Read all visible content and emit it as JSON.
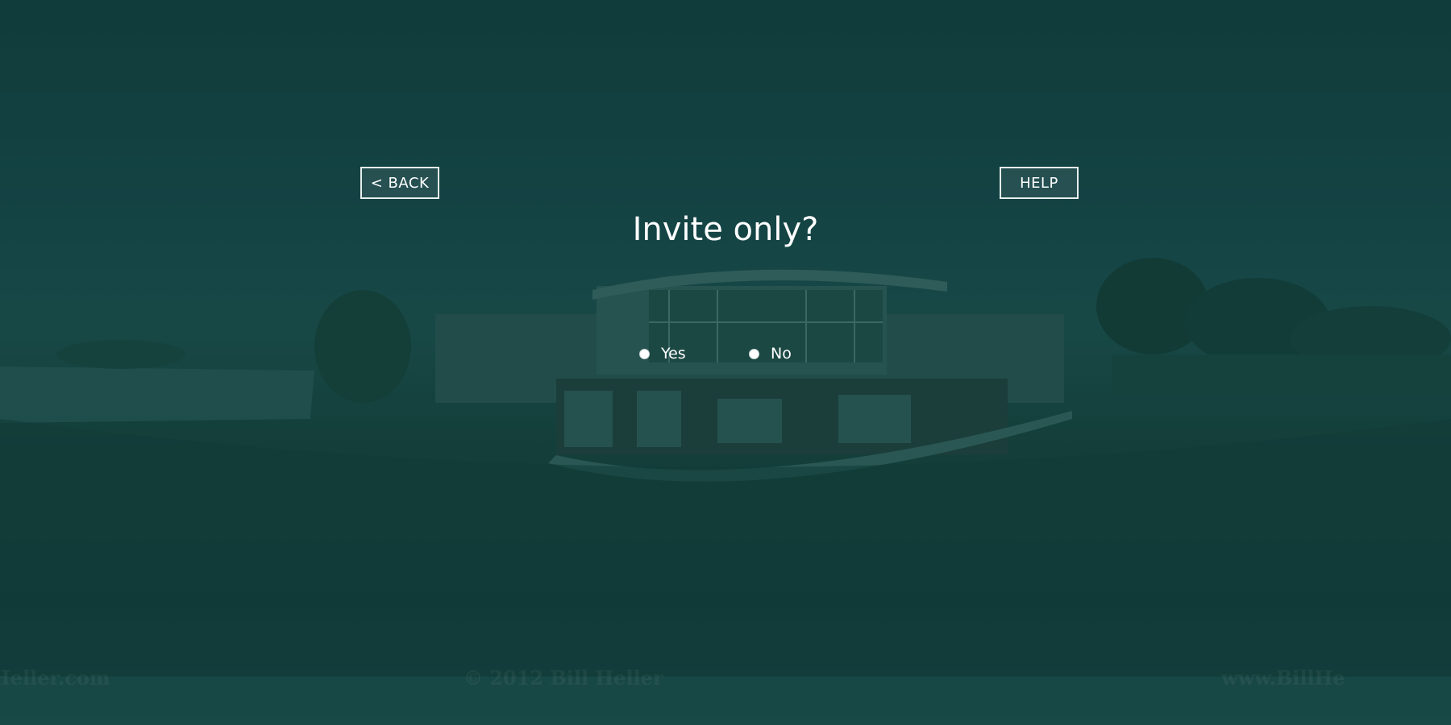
{
  "nav": {
    "back_label": "< BACK",
    "help_label": "HELP"
  },
  "question": {
    "title": "Invite only?"
  },
  "options": [
    {
      "label": "Yes",
      "selected": false
    },
    {
      "label": "No",
      "selected": false
    }
  ],
  "background": {
    "watermark": [
      "Heller.com",
      "© 2012 Bill Heller",
      "www.BillHe"
    ]
  },
  "colors": {
    "overlay": "#1a4a47",
    "text": "#ffffff",
    "button_border": "#e7eeee"
  }
}
